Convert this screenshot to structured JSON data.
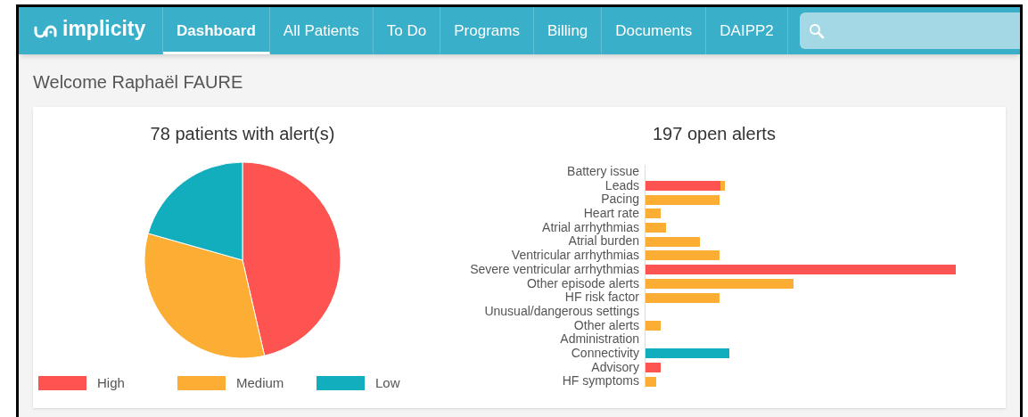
{
  "nav": {
    "logo": "implicity",
    "tabs": [
      {
        "label": "Dashboard",
        "selected": true
      },
      {
        "label": "All Patients",
        "selected": false
      },
      {
        "label": "To Do",
        "selected": false
      },
      {
        "label": "Programs",
        "selected": false
      },
      {
        "label": "Billing",
        "selected": false
      },
      {
        "label": "Documents",
        "selected": false
      },
      {
        "label": "DAIPP2",
        "selected": false
      }
    ]
  },
  "welcome": "Welcome Raphaël FAURE",
  "patients_chart": {
    "title": "78 patients with alert(s)",
    "legend": [
      {
        "label": "High",
        "color": "#fd5451"
      },
      {
        "label": "Medium",
        "color": "#fcad33"
      },
      {
        "label": "Low",
        "color": "#12aebd"
      }
    ]
  },
  "alerts_chart": {
    "title": "197 open alerts",
    "categories": [
      "Battery issue",
      "Leads",
      "Pacing",
      "Heart rate",
      "Atrial arrhythmias",
      "Atrial burden",
      "Ventricular arrhythmias",
      "Severe ventricular arrhythmias",
      "Other episode alerts",
      "HF risk factor",
      "Unusual/dangerous settings",
      "Other alerts",
      "Administration",
      "Connectivity",
      "Advisory",
      "HF symptoms"
    ]
  }
}
